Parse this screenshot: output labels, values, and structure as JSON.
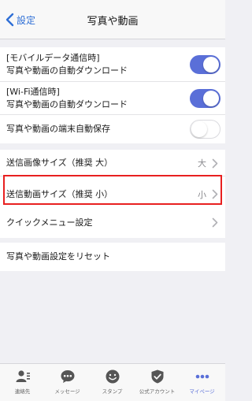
{
  "nav": {
    "back_label": "設定",
    "title": "写真や動画"
  },
  "auto_download": [
    {
      "line1": "[モバイルデータ通信時]",
      "line2": "写真や動画の自動ダウンロード",
      "state": "on"
    },
    {
      "line1": "[Wi-Fi通信時]",
      "line2": "写真や動画の自動ダウンロード",
      "state": "on"
    },
    {
      "label": "写真や動画の端末自動保存",
      "state": "off"
    }
  ],
  "send_sizes": [
    {
      "label": "送信画像サイズ（推奨 大）",
      "value": "大"
    },
    {
      "label": "送信動画サイズ（推奨 小）",
      "value": "小"
    }
  ],
  "quick_menu": {
    "label": "クイックメニュー設定"
  },
  "reset": {
    "label": "写真や動画設定をリセット"
  },
  "tabbar": {
    "items": [
      {
        "label": "連絡先",
        "icon": "contacts-icon"
      },
      {
        "label": "メッセージ",
        "icon": "message-icon"
      },
      {
        "label": "スタンプ",
        "icon": "stamp-icon"
      },
      {
        "label": "公式アカウント",
        "icon": "official-account-icon"
      },
      {
        "label": "マイページ",
        "icon": "mypage-icon",
        "active": true
      }
    ]
  },
  "colors": {
    "accent": "#5a6fd8",
    "link": "#2f6fd6",
    "highlight": "#e82020"
  }
}
